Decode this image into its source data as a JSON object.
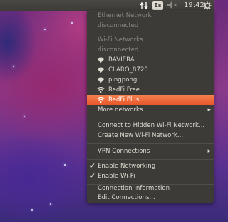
{
  "panel": {
    "keyboard_layout": "Es",
    "clock": "19:42",
    "icons": [
      "network-arrows-icon",
      "volume-icon",
      "gear-icon"
    ]
  },
  "menu": {
    "ethernet_header": "Ethernet Network",
    "ethernet_status": "disconnected",
    "wifi_header": "Wi-Fi Networks",
    "wifi_status": "disconnected",
    "networks": [
      "BAVIERA",
      "CLARO_8720",
      "pingpong",
      "RedFi Free",
      "RedFi Plus"
    ],
    "active_network": "RedFi Plus",
    "more_networks": "More networks",
    "connect_hidden": "Connect to Hidden Wi-Fi Network...",
    "create_new": "Create New Wi-Fi Network...",
    "vpn_connections": "VPN Connections",
    "enable_networking": "Enable Networking",
    "enable_wifi": "Enable Wi-Fi",
    "connection_information": "Connection Information",
    "edit_connections": "Edit Connections..."
  },
  "colors": {
    "panel_bg": "#3c3b37",
    "menu_bg": "#3c3b37",
    "highlight": "#f07746",
    "text": "#dfdbd2",
    "disabled_text": "#8b8880"
  }
}
